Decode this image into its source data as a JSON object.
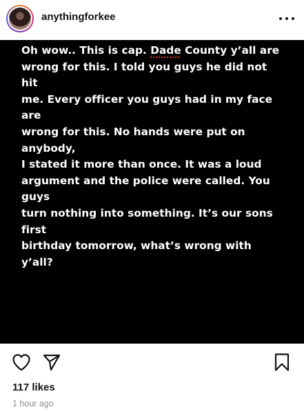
{
  "header": {
    "username": "anythingforkee"
  },
  "post": {
    "lines": [
      {
        "before": "Oh wow.. This is cap. ",
        "highlight": "Dade",
        "after": " County y’all are"
      },
      {
        "before": "wrong for this. I told you guys he did not hit",
        "highlight": "",
        "after": ""
      },
      {
        "before": "me. Every officer you guys had in my face are",
        "highlight": "",
        "after": ""
      },
      {
        "before": "wrong for this. No hands were put on anybody,",
        "highlight": "",
        "after": ""
      },
      {
        "before": "I stated it more than once. It was a loud",
        "highlight": "",
        "after": ""
      },
      {
        "before": "argument and the police were called. You guys",
        "highlight": "",
        "after": ""
      },
      {
        "before": "turn nothing into something. It’s our sons first",
        "highlight": "",
        "after": ""
      },
      {
        "before": "birthday tomorrow, what’s wrong with y’all?",
        "highlight": "",
        "after": ""
      }
    ]
  },
  "footer": {
    "likes": "117 likes",
    "time": "1 hour ago"
  },
  "icons": {
    "heart": "heart-icon",
    "share": "paper-plane-icon",
    "save": "bookmark-icon",
    "more": "more-horizontal-icon"
  }
}
